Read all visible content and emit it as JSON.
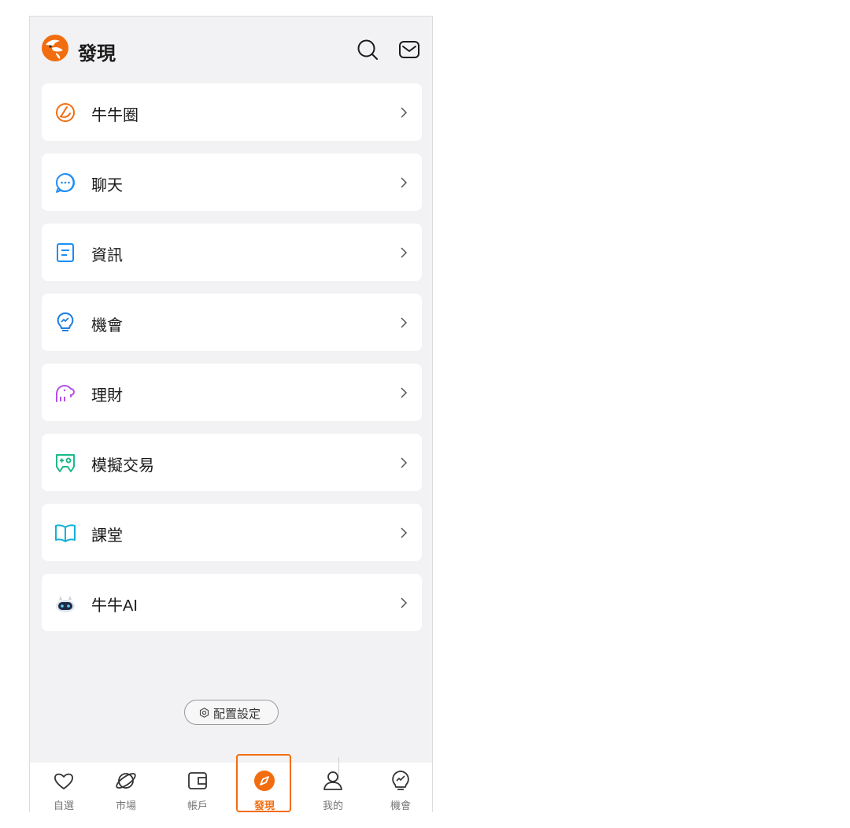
{
  "header": {
    "title": "發現",
    "logo_icon": "futu-logo-icon",
    "search_icon": "search-icon",
    "mail_icon": "mail-icon"
  },
  "menu": {
    "items": [
      {
        "label": "牛牛圈",
        "icon": "circle-moon-icon",
        "color": "#f26d0f"
      },
      {
        "label": "聊天",
        "icon": "chat-bubble-icon",
        "color": "#1e8ef5"
      },
      {
        "label": "資訊",
        "icon": "document-icon",
        "color": "#1e8ef5"
      },
      {
        "label": "機會",
        "icon": "lightbulb-trend-icon",
        "color": "#1e7fe0"
      },
      {
        "label": "理財",
        "icon": "elephant-icon",
        "color": "#b44fe3"
      },
      {
        "label": "模擬交易",
        "icon": "gamepad-icon",
        "color": "#1cb98a"
      },
      {
        "label": "課堂",
        "icon": "open-book-icon",
        "color": "#14b1d6"
      },
      {
        "label": "牛牛AI",
        "icon": "robot-icon",
        "color": "#4a6fa0"
      }
    ]
  },
  "config_button": {
    "label": "配置設定",
    "icon": "gear-icon"
  },
  "tabbar": {
    "tabs": [
      {
        "label": "自選",
        "icon": "heart-icon"
      },
      {
        "label": "市場",
        "icon": "planet-icon"
      },
      {
        "label": "帳戶",
        "icon": "wallet-icon"
      },
      {
        "label": "發現",
        "icon": "compass-icon",
        "active": true
      },
      {
        "label": "我的",
        "icon": "person-icon"
      },
      {
        "label": "機會",
        "icon": "lightbulb-trend-icon"
      }
    ],
    "active_color": "#f26d0f"
  }
}
